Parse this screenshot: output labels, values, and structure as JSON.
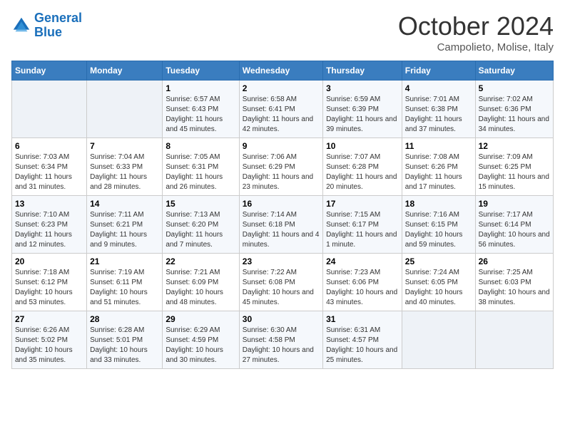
{
  "header": {
    "logo_line1": "General",
    "logo_line2": "Blue",
    "month": "October 2024",
    "location": "Campolieto, Molise, Italy"
  },
  "days_of_week": [
    "Sunday",
    "Monday",
    "Tuesday",
    "Wednesday",
    "Thursday",
    "Friday",
    "Saturday"
  ],
  "weeks": [
    [
      {
        "day": "",
        "sunrise": "",
        "sunset": "",
        "daylight": ""
      },
      {
        "day": "",
        "sunrise": "",
        "sunset": "",
        "daylight": ""
      },
      {
        "day": "1",
        "sunrise": "Sunrise: 6:57 AM",
        "sunset": "Sunset: 6:43 PM",
        "daylight": "Daylight: 11 hours and 45 minutes."
      },
      {
        "day": "2",
        "sunrise": "Sunrise: 6:58 AM",
        "sunset": "Sunset: 6:41 PM",
        "daylight": "Daylight: 11 hours and 42 minutes."
      },
      {
        "day": "3",
        "sunrise": "Sunrise: 6:59 AM",
        "sunset": "Sunset: 6:39 PM",
        "daylight": "Daylight: 11 hours and 39 minutes."
      },
      {
        "day": "4",
        "sunrise": "Sunrise: 7:01 AM",
        "sunset": "Sunset: 6:38 PM",
        "daylight": "Daylight: 11 hours and 37 minutes."
      },
      {
        "day": "5",
        "sunrise": "Sunrise: 7:02 AM",
        "sunset": "Sunset: 6:36 PM",
        "daylight": "Daylight: 11 hours and 34 minutes."
      }
    ],
    [
      {
        "day": "6",
        "sunrise": "Sunrise: 7:03 AM",
        "sunset": "Sunset: 6:34 PM",
        "daylight": "Daylight: 11 hours and 31 minutes."
      },
      {
        "day": "7",
        "sunrise": "Sunrise: 7:04 AM",
        "sunset": "Sunset: 6:33 PM",
        "daylight": "Daylight: 11 hours and 28 minutes."
      },
      {
        "day": "8",
        "sunrise": "Sunrise: 7:05 AM",
        "sunset": "Sunset: 6:31 PM",
        "daylight": "Daylight: 11 hours and 26 minutes."
      },
      {
        "day": "9",
        "sunrise": "Sunrise: 7:06 AM",
        "sunset": "Sunset: 6:29 PM",
        "daylight": "Daylight: 11 hours and 23 minutes."
      },
      {
        "day": "10",
        "sunrise": "Sunrise: 7:07 AM",
        "sunset": "Sunset: 6:28 PM",
        "daylight": "Daylight: 11 hours and 20 minutes."
      },
      {
        "day": "11",
        "sunrise": "Sunrise: 7:08 AM",
        "sunset": "Sunset: 6:26 PM",
        "daylight": "Daylight: 11 hours and 17 minutes."
      },
      {
        "day": "12",
        "sunrise": "Sunrise: 7:09 AM",
        "sunset": "Sunset: 6:25 PM",
        "daylight": "Daylight: 11 hours and 15 minutes."
      }
    ],
    [
      {
        "day": "13",
        "sunrise": "Sunrise: 7:10 AM",
        "sunset": "Sunset: 6:23 PM",
        "daylight": "Daylight: 11 hours and 12 minutes."
      },
      {
        "day": "14",
        "sunrise": "Sunrise: 7:11 AM",
        "sunset": "Sunset: 6:21 PM",
        "daylight": "Daylight: 11 hours and 9 minutes."
      },
      {
        "day": "15",
        "sunrise": "Sunrise: 7:13 AM",
        "sunset": "Sunset: 6:20 PM",
        "daylight": "Daylight: 11 hours and 7 minutes."
      },
      {
        "day": "16",
        "sunrise": "Sunrise: 7:14 AM",
        "sunset": "Sunset: 6:18 PM",
        "daylight": "Daylight: 11 hours and 4 minutes."
      },
      {
        "day": "17",
        "sunrise": "Sunrise: 7:15 AM",
        "sunset": "Sunset: 6:17 PM",
        "daylight": "Daylight: 11 hours and 1 minute."
      },
      {
        "day": "18",
        "sunrise": "Sunrise: 7:16 AM",
        "sunset": "Sunset: 6:15 PM",
        "daylight": "Daylight: 10 hours and 59 minutes."
      },
      {
        "day": "19",
        "sunrise": "Sunrise: 7:17 AM",
        "sunset": "Sunset: 6:14 PM",
        "daylight": "Daylight: 10 hours and 56 minutes."
      }
    ],
    [
      {
        "day": "20",
        "sunrise": "Sunrise: 7:18 AM",
        "sunset": "Sunset: 6:12 PM",
        "daylight": "Daylight: 10 hours and 53 minutes."
      },
      {
        "day": "21",
        "sunrise": "Sunrise: 7:19 AM",
        "sunset": "Sunset: 6:11 PM",
        "daylight": "Daylight: 10 hours and 51 minutes."
      },
      {
        "day": "22",
        "sunrise": "Sunrise: 7:21 AM",
        "sunset": "Sunset: 6:09 PM",
        "daylight": "Daylight: 10 hours and 48 minutes."
      },
      {
        "day": "23",
        "sunrise": "Sunrise: 7:22 AM",
        "sunset": "Sunset: 6:08 PM",
        "daylight": "Daylight: 10 hours and 45 minutes."
      },
      {
        "day": "24",
        "sunrise": "Sunrise: 7:23 AM",
        "sunset": "Sunset: 6:06 PM",
        "daylight": "Daylight: 10 hours and 43 minutes."
      },
      {
        "day": "25",
        "sunrise": "Sunrise: 7:24 AM",
        "sunset": "Sunset: 6:05 PM",
        "daylight": "Daylight: 10 hours and 40 minutes."
      },
      {
        "day": "26",
        "sunrise": "Sunrise: 7:25 AM",
        "sunset": "Sunset: 6:03 PM",
        "daylight": "Daylight: 10 hours and 38 minutes."
      }
    ],
    [
      {
        "day": "27",
        "sunrise": "Sunrise: 6:26 AM",
        "sunset": "Sunset: 5:02 PM",
        "daylight": "Daylight: 10 hours and 35 minutes."
      },
      {
        "day": "28",
        "sunrise": "Sunrise: 6:28 AM",
        "sunset": "Sunset: 5:01 PM",
        "daylight": "Daylight: 10 hours and 33 minutes."
      },
      {
        "day": "29",
        "sunrise": "Sunrise: 6:29 AM",
        "sunset": "Sunset: 4:59 PM",
        "daylight": "Daylight: 10 hours and 30 minutes."
      },
      {
        "day": "30",
        "sunrise": "Sunrise: 6:30 AM",
        "sunset": "Sunset: 4:58 PM",
        "daylight": "Daylight: 10 hours and 27 minutes."
      },
      {
        "day": "31",
        "sunrise": "Sunrise: 6:31 AM",
        "sunset": "Sunset: 4:57 PM",
        "daylight": "Daylight: 10 hours and 25 minutes."
      },
      {
        "day": "",
        "sunrise": "",
        "sunset": "",
        "daylight": ""
      },
      {
        "day": "",
        "sunrise": "",
        "sunset": "",
        "daylight": ""
      }
    ]
  ]
}
